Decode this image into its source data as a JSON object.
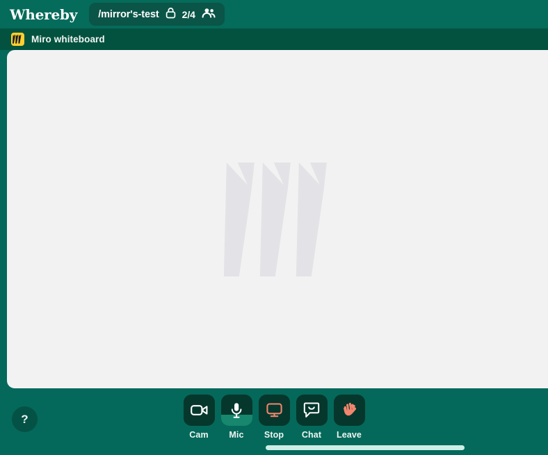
{
  "app": {
    "brand": "Whereby",
    "background_color": "#04695a"
  },
  "topbar": {
    "brand_label": "Whereby",
    "room": {
      "name": "/mirror's-test",
      "lock_icon": "lock-icon",
      "participant_count": "2/4",
      "people_icon": "people-icon"
    }
  },
  "content_header": {
    "app_icon": "miro-icon",
    "title": "Miro whiteboard"
  },
  "board": {
    "watermark": "miro-logo-watermark",
    "background_color": "#f2f2f2"
  },
  "help": {
    "label": "?",
    "name": "help-button"
  },
  "toolbar": {
    "items": [
      {
        "label": "Cam",
        "icon": "video-camera-icon",
        "active": false
      },
      {
        "label": "Mic",
        "icon": "microphone-icon",
        "active": true
      },
      {
        "label": "Stop",
        "icon": "screen-share-icon",
        "active": false
      },
      {
        "label": "Chat",
        "icon": "chat-bubble-icon",
        "active": false
      },
      {
        "label": "Leave",
        "icon": "waving-hand-icon",
        "active": false
      }
    ],
    "mic_level_color": "#17876e",
    "button_color": "#05372d"
  },
  "scrollbar": {
    "orientation": "horizontal",
    "thumb_color": "#cdeee7"
  }
}
